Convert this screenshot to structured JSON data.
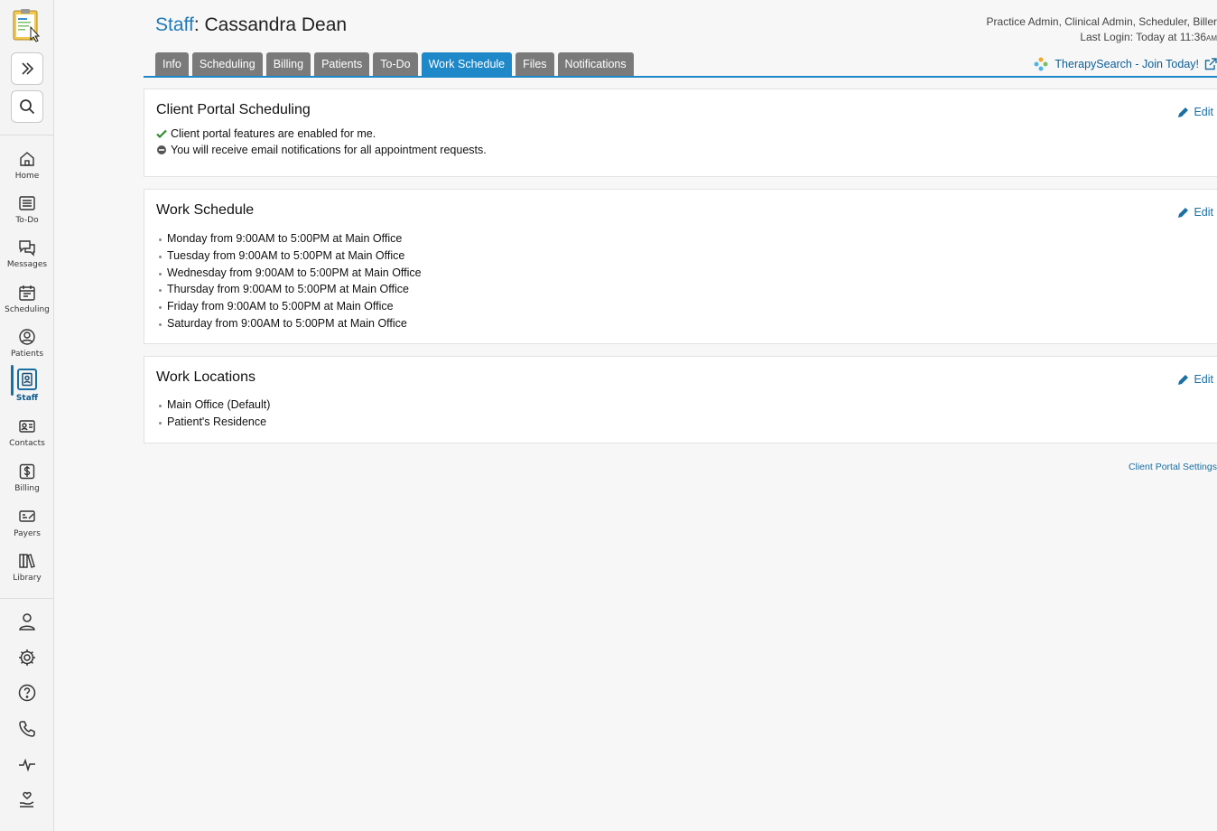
{
  "sidebar": {
    "nav": [
      {
        "key": "home",
        "label": "Home",
        "icon": "home-icon"
      },
      {
        "key": "todo",
        "label": "To-Do",
        "icon": "list-icon"
      },
      {
        "key": "messages",
        "label": "Messages",
        "icon": "chat-icon"
      },
      {
        "key": "scheduling",
        "label": "Scheduling",
        "icon": "calendar-icon"
      },
      {
        "key": "patients",
        "label": "Patients",
        "icon": "user-circle-icon"
      },
      {
        "key": "staff",
        "label": "Staff",
        "icon": "badge-icon",
        "active": true
      },
      {
        "key": "contacts",
        "label": "Contacts",
        "icon": "contact-card-icon"
      },
      {
        "key": "billing",
        "label": "Billing",
        "icon": "dollar-icon"
      },
      {
        "key": "payers",
        "label": "Payers",
        "icon": "payment-icon"
      },
      {
        "key": "library",
        "label": "Library",
        "icon": "books-icon"
      }
    ],
    "utilities": [
      "user-icon",
      "gear-icon",
      "help-icon",
      "phone-icon",
      "pulse-icon",
      "hand-heart-icon"
    ],
    "accent_color": "#1a6fa3"
  },
  "header": {
    "breadcrumb": "Staff",
    "separator": ": ",
    "name": "Cassandra Dean",
    "roles": "Practice Admin, Clinical Admin, Scheduler, Biller",
    "last_login": "Last Login: Today at 11:36",
    "last_login_ampm": "AM"
  },
  "tabs": [
    {
      "label": "Info",
      "active": false
    },
    {
      "label": "Scheduling",
      "active": false
    },
    {
      "label": "Billing",
      "active": false
    },
    {
      "label": "Patients",
      "active": false
    },
    {
      "label": "To-Do",
      "active": false
    },
    {
      "label": "Work Schedule",
      "active": true
    },
    {
      "label": "Files",
      "active": false
    },
    {
      "label": "Notifications",
      "active": false
    }
  ],
  "promo": {
    "label": "TherapySearch - Join Today!"
  },
  "portal": {
    "title": "Client Portal Scheduling",
    "edit": "Edit",
    "line1": "Client portal features are enabled for me.",
    "line2": "You will receive email notifications for all appointment requests."
  },
  "schedule": {
    "title": "Work Schedule",
    "edit": "Edit",
    "items": [
      "Monday from 9:00AM to 5:00PM at Main Office",
      "Tuesday from 9:00AM to 5:00PM at Main Office",
      "Wednesday from 9:00AM to 5:00PM at Main Office",
      "Thursday from 9:00AM to 5:00PM at Main Office",
      "Friday from 9:00AM to 5:00PM at Main Office",
      "Saturday from 9:00AM to 5:00PM at Main Office"
    ]
  },
  "locations": {
    "title": "Work Locations",
    "edit": "Edit",
    "items": [
      "Main Office (Default)",
      "Patient's Residence"
    ]
  },
  "footer": {
    "portal_settings_link": "Client Portal Settings"
  },
  "colors": {
    "accent": "#1e88c8",
    "link": "#1a6fa3",
    "tab_inactive": "#7a7a7a",
    "success": "#2e8b2e"
  }
}
